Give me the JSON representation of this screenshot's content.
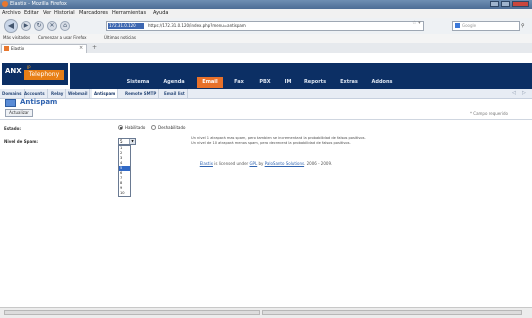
{
  "window": {
    "title": "Elastix - Mozilla Firefox"
  },
  "menubar": {
    "items": [
      "Archivo",
      "Editar",
      "Ver",
      "Historial",
      "Marcadores",
      "Herramientas",
      "Ayuda"
    ]
  },
  "toolbar": {
    "site_identity": "172.31.0.120",
    "url": "https://172.31.0.120/index.php?menu=antispam",
    "search_placeholder": "Google"
  },
  "bookmarks": {
    "items": [
      "Más visitados",
      "Comenzar a usar Firefox",
      "Últimas noticias"
    ]
  },
  "tab": {
    "label": "Elastix"
  },
  "header": {
    "logo_top": "IP",
    "logo_anx": "ANX",
    "logo_brand": "Telephony",
    "top_links": "About us  •  Help  •  Cerrar Sesión (admin)",
    "menu": [
      "Sistema",
      "Agenda",
      "Email",
      "Fax",
      "PBX",
      "IM",
      "Reports",
      "Extras",
      "Addons"
    ],
    "active_menu": "Email"
  },
  "submenu": {
    "items": [
      "Domains",
      "Accounts",
      "Relay",
      "Webmail",
      "Antispam",
      "Remote SMTP",
      "Email list"
    ],
    "active": "Antispam"
  },
  "page": {
    "title": "Antispam",
    "apply_button": "Actualizar",
    "required_note": "* Campo requerido"
  },
  "form": {
    "estado_label": "Estado:",
    "radio_on_label": "Habilitado",
    "radio_off_label": "Deshabilitado",
    "nivel_label": "Nivel de Spam:",
    "level_value": "5",
    "level_options": [
      "1",
      "2",
      "3",
      "4",
      "5",
      "6",
      "7",
      "8",
      "9",
      "10"
    ],
    "selected_level": "5",
    "help_line1": "Un nivel 1 atrapará mas spam, pero tambien se incrementará la probabilidad de falsos positivos.",
    "help_line2": "Un nivel de 10 atrapará menos spam, pero decrecerá la probabilidad de falsos positivos."
  },
  "footer": {
    "product": "Elastix",
    "text1": " is licensed under ",
    "license": "GPL",
    "text2": " by ",
    "company": "PaloSanto Solutions",
    "years": ". 2006 - 2009."
  }
}
